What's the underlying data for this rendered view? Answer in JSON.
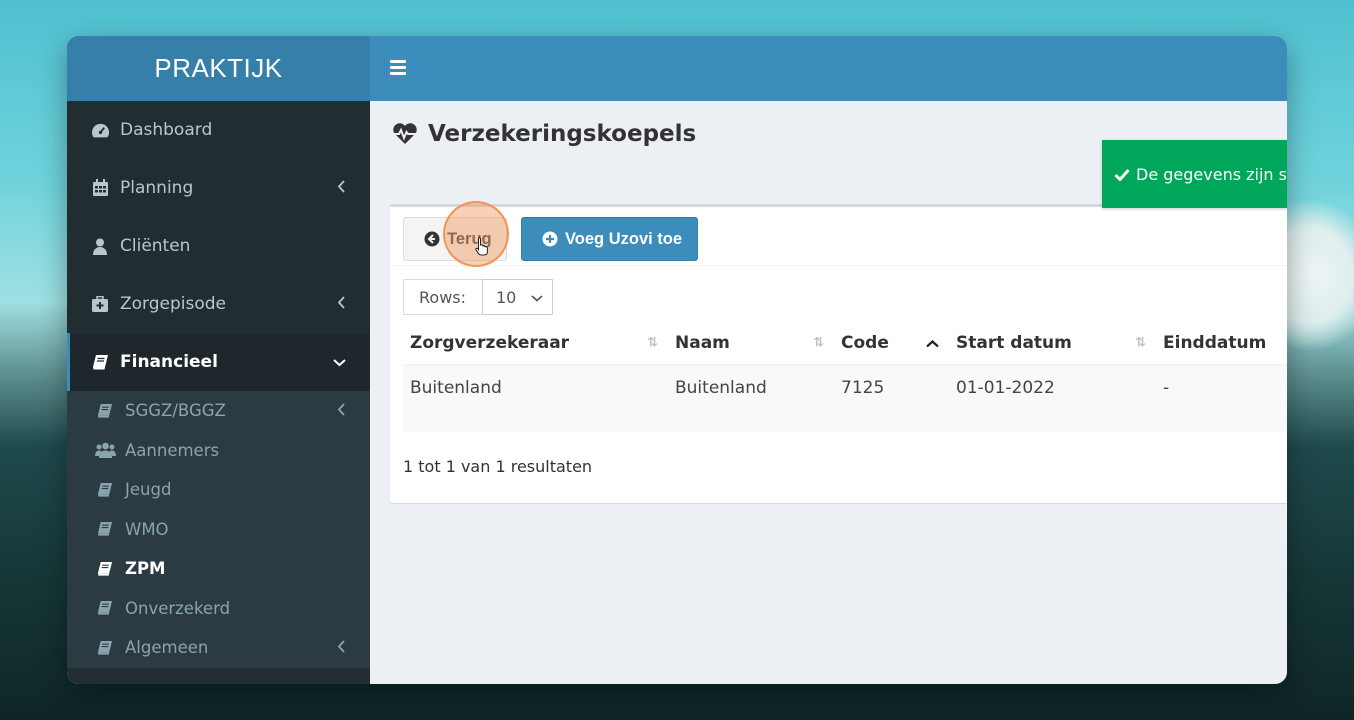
{
  "app": {
    "logo": "PRAKTIJK"
  },
  "sidebar": {
    "items": [
      {
        "label": "Dashboard",
        "icon": "dashboard-icon",
        "chevron": false
      },
      {
        "label": "Planning",
        "icon": "calendar-icon",
        "chevron": true
      },
      {
        "label": "Cliënten",
        "icon": "user-icon",
        "chevron": false
      },
      {
        "label": "Zorgepisode",
        "icon": "medkit-icon",
        "chevron": true
      },
      {
        "label": "Financieel",
        "icon": "book-icon",
        "chevron": true,
        "expanded": true
      }
    ],
    "subitems": [
      {
        "label": "SGGZ/BGGZ",
        "icon": "book-icon",
        "chevron": true
      },
      {
        "label": "Aannemers",
        "icon": "users-icon",
        "chevron": false
      },
      {
        "label": "Jeugd",
        "icon": "book-icon",
        "chevron": false
      },
      {
        "label": "WMO",
        "icon": "book-icon",
        "chevron": false
      },
      {
        "label": "ZPM",
        "icon": "book-icon",
        "chevron": false,
        "active": true
      },
      {
        "label": "Onverzekerd",
        "icon": "book-icon",
        "chevron": false
      },
      {
        "label": "Algemeen",
        "icon": "book-icon",
        "chevron": true
      }
    ]
  },
  "page": {
    "title": "Verzekeringskoepels",
    "icon": "heartbeat-icon"
  },
  "toast": {
    "message": "De gegevens zijn succesvol gewijzigd, dank je wel !!",
    "color": "#00a65a"
  },
  "toolbar": {
    "back_label": "Terug",
    "add_label": "Voeg Uzovi toe"
  },
  "rows": {
    "label": "Rows:",
    "value": "10"
  },
  "table": {
    "columns": [
      "Zorgverzekeraar",
      "Naam",
      "Code",
      "Start datum",
      "Einddatum"
    ],
    "rows": [
      [
        "Buitenland",
        "Buitenland",
        "7125",
        "01-01-2022",
        "-"
      ]
    ]
  },
  "footer": {
    "info": "1 tot 1 van 1 resultaten"
  },
  "colors": {
    "header": "#3c8dbc",
    "logo": "#367fa9",
    "sidebar": "#222d32",
    "success": "#00a65a"
  }
}
